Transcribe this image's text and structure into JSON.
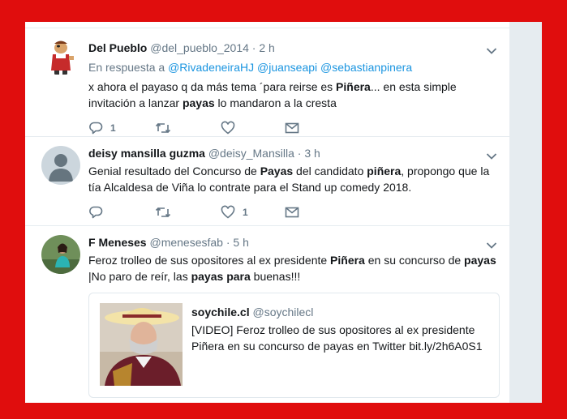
{
  "colors": {
    "frame": "#e00d0d",
    "accent": "#1b95e0",
    "text": "#14171a",
    "muted": "#657786",
    "divider": "#e6ecf0"
  },
  "tweets": [
    {
      "avatar_icon": "cartoon-avatar",
      "name": "Del Pueblo",
      "handle": "@del_pueblo_2014",
      "dot": "·",
      "time": "2 h",
      "reply_prefix": "En respuesta a",
      "mentions": [
        "@RivadeneiraHJ",
        "@juanseapi",
        "@sebastianpinera"
      ],
      "text_parts": [
        "x ahora el payaso q da más tema ´para reirse es ",
        "Piñera",
        "... en esta simple invitación a lanzar ",
        "payas",
        " lo mandaron a la cresta"
      ],
      "reply_count": "1",
      "retweet_count": "",
      "like_count": ""
    },
    {
      "avatar_icon": "default-avatar",
      "name": "deisy mansilla guzma",
      "handle": "@deisy_Mansilla",
      "dot": "·",
      "time": "3 h",
      "text_parts": [
        "Genial resultado del Concurso de ",
        "Payas",
        " del candidato ",
        "piñera",
        ", propongo que la tía Alcaldesa de Viña lo contrate para el Stand up comedy 2018."
      ],
      "reply_count": "",
      "retweet_count": "",
      "like_count": "1"
    },
    {
      "avatar_icon": "photo-avatar",
      "name": "F Meneses",
      "handle": "@menesesfab",
      "dot": "·",
      "time": "5 h",
      "text_parts": [
        "Feroz trolleo de sus opositores al ex presidente ",
        "Piñera",
        " en su concurso de ",
        "payas",
        " |No paro de reír, las ",
        "payas",
        " ",
        "para",
        " buenas!!!"
      ],
      "quote": {
        "name": "soychile.cl",
        "handle": "@soychilecl",
        "text": "[VIDEO] Feroz trolleo de sus opositores al ex presidente Piñera en su concurso de payas en Twitter bit.ly/2h6A0S1"
      }
    }
  ]
}
